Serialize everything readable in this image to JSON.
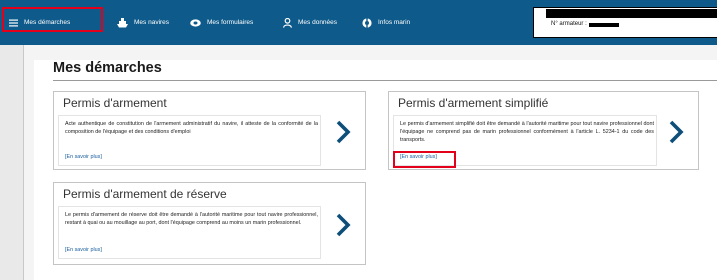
{
  "nav": {
    "items": [
      {
        "label": "Mes démarches",
        "icon": "menu-icon"
      },
      {
        "label": "Mes navires",
        "icon": "ship-icon"
      },
      {
        "label": "Mes formulaires",
        "icon": "form-icon"
      },
      {
        "label": "Mes données",
        "icon": "user-icon"
      },
      {
        "label": "Infos marin",
        "icon": "life-ring-icon"
      }
    ],
    "account_label": "N° armateur :"
  },
  "page": {
    "title": "Mes démarches"
  },
  "cards": [
    {
      "title": "Permis d'armement",
      "text": "Acte authentique de constitution de l'armement administratif du navire, il atteste de la conformité de la composition de l'équipage et des conditions d'emploi",
      "link": "[En savoir plus]"
    },
    {
      "title": "Permis d'armement simplifié",
      "text": "Le permis d'armement simplifié doit être demandé à l'autorité maritime pour tout navire professionnel dont l'équipage ne comprend pas de marin professionnel conformément à l'article L. 5234-1 du code des transports.",
      "link": "[En savoir plus]"
    },
    {
      "title": "Permis d'armement de réserve",
      "text": "Le permis d'armement de réserve doit être demandé à l'autorité maritime pour tout navire professionnel, restant à quai ou au mouillage au port, dont l'équipage comprend au moins un marin professionnel.",
      "link": "[En savoir plus]"
    }
  ],
  "colors": {
    "nav_bg": "#0e5a8a",
    "highlight": "#e3001b",
    "chevron": "#0e4f7a",
    "link": "#1a5fa0"
  }
}
